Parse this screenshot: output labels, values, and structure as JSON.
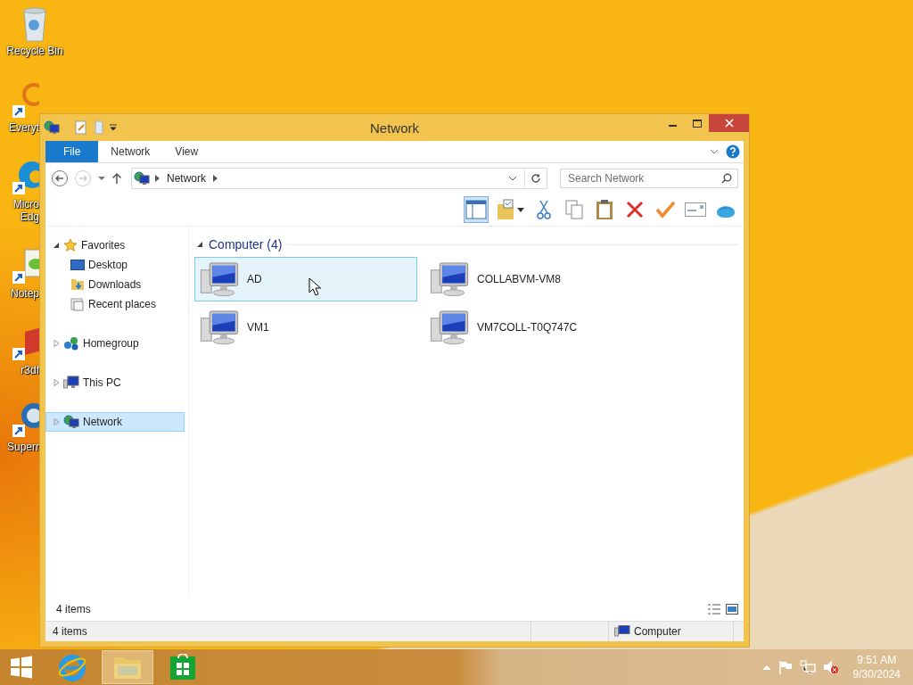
{
  "desktop_icons": [
    {
      "label_lines": [
        "Recycle Bin"
      ],
      "clipped": false,
      "kind": "bin"
    },
    {
      "label_lines": [
        "Everyt"
      ],
      "clipped": true,
      "kind": "search"
    },
    {
      "label_lines": [
        "Micro",
        "Edg"
      ],
      "clipped": true,
      "kind": "edge"
    },
    {
      "label_lines": [
        "Notep"
      ],
      "clipped": true,
      "kind": "notepad"
    },
    {
      "label_lines": [
        "r3df"
      ],
      "clipped": true,
      "kind": "red"
    },
    {
      "label_lines": [
        "Superr"
      ],
      "clipped": true,
      "kind": "globe"
    }
  ],
  "window": {
    "title": "Network"
  },
  "ribbon_tabs": [
    {
      "label": "File",
      "kind": "file"
    },
    {
      "label": "Network",
      "kind": "tab"
    },
    {
      "label": "View",
      "kind": "tab"
    }
  ],
  "address_bar": {
    "path": [
      "Network"
    ]
  },
  "search": {
    "placeholder": "Search Network"
  },
  "toolbar": {
    "preview_pane_on": true
  },
  "navigation": [
    {
      "label": "Favorites",
      "kind": "favorites",
      "expanded": true,
      "selected": false,
      "children": [
        {
          "label": "Desktop",
          "kind": "desktop",
          "selected": false
        },
        {
          "label": "Downloads",
          "kind": "downloads",
          "selected": false
        },
        {
          "label": "Recent places",
          "kind": "recent",
          "selected": false
        }
      ]
    },
    {
      "label": "Homegroup",
      "kind": "homegroup",
      "expanded": false,
      "selected": false
    },
    {
      "label": "This PC",
      "kind": "pc",
      "expanded": false,
      "selected": false
    },
    {
      "label": "Network",
      "kind": "network",
      "expanded": false,
      "selected": true
    }
  ],
  "group": {
    "title": "Computer (4)",
    "expanded": true
  },
  "items": [
    {
      "name": "AD",
      "selected": true
    },
    {
      "name": "COLLABVM-VM8",
      "selected": false
    },
    {
      "name": "VM1",
      "selected": false
    },
    {
      "name": "VM7COLL-T0Q747C",
      "selected": false
    }
  ],
  "item_count": "4 items",
  "status_bar": {
    "count": "4 items",
    "zone": "Computer"
  },
  "taskbar": {
    "apps": [
      {
        "kind": "ie",
        "selected": false
      },
      {
        "kind": "explorer",
        "selected": true
      },
      {
        "kind": "store",
        "selected": false
      }
    ],
    "time": "9:51 AM",
    "date": "9/30/2024",
    "volume_muted": true
  }
}
